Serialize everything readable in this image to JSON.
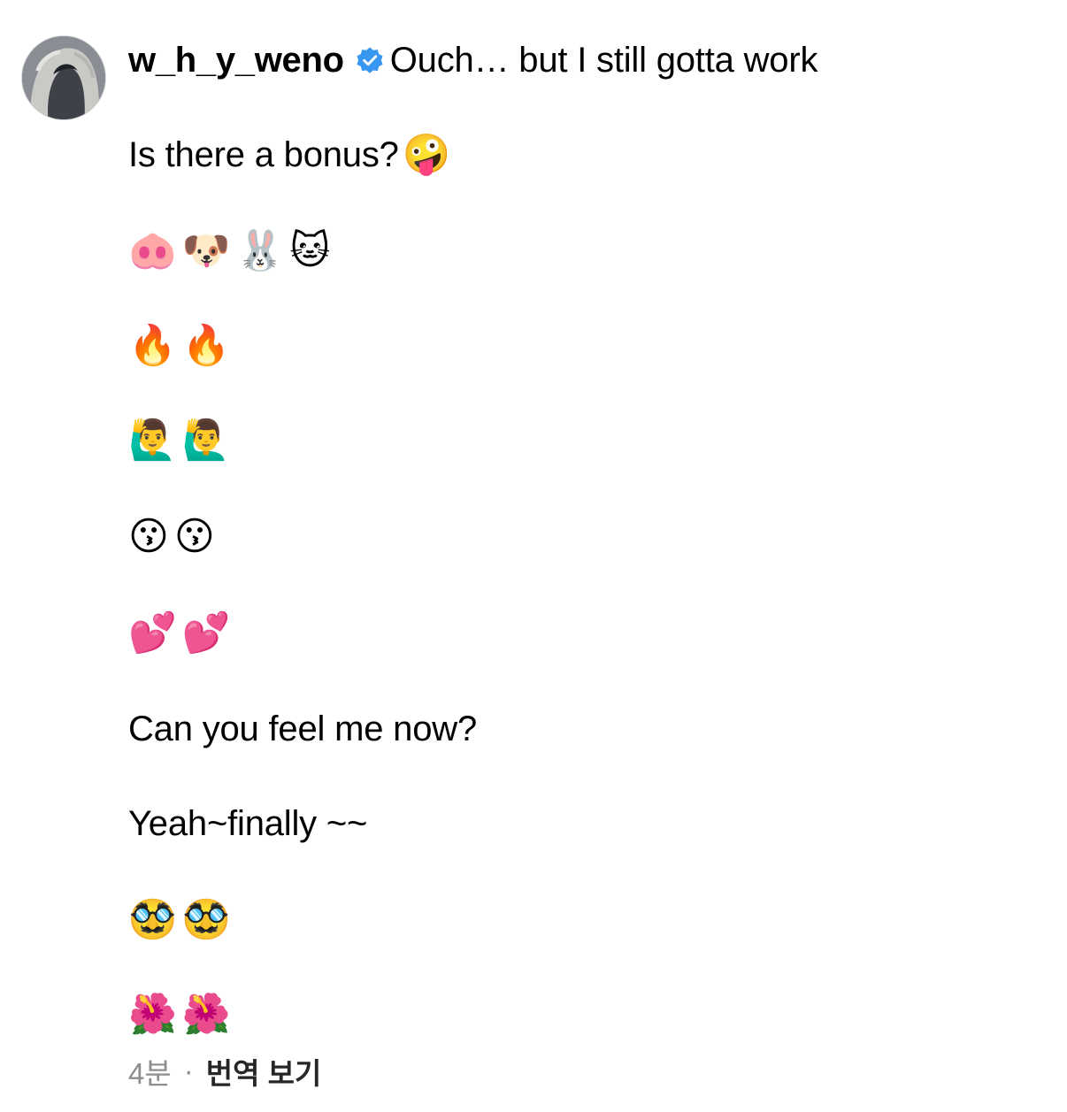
{
  "comment": {
    "username": "w_h_y_weno",
    "verified_icon": "verified-badge-icon",
    "verified_color": "#3897f0",
    "first_line": "Ouch… but I still gotta work",
    "lines": [
      {
        "text": "Is there a bonus?",
        "emoji": "🤪"
      },
      {
        "emoji": "🐽🐶🐰🐱"
      },
      {
        "emoji": "🔥🔥"
      },
      {
        "emoji": "🙋‍♂️🙋‍♂️"
      },
      {
        "emoji": "😗😗"
      },
      {
        "emoji": "💕💕"
      },
      {
        "text": "Can you feel me now?"
      },
      {
        "text": "Yeah~finally ~~"
      },
      {
        "emoji": "🥸🥸"
      },
      {
        "emoji": "🌺🌺"
      }
    ],
    "timestamp": "4분",
    "separator": "·",
    "translate_label": "번역 보기"
  }
}
